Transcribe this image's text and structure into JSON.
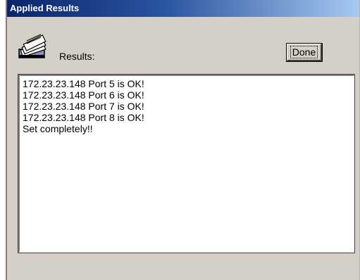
{
  "window": {
    "title": "Applied Results"
  },
  "header": {
    "icon": "card-file-icon",
    "results_label": "Results:"
  },
  "toolbar": {
    "done_label": "Done"
  },
  "results": {
    "lines": [
      "172.23.23.148 Port 5 is OK!",
      "172.23.23.148 Port 6 is OK!",
      "172.23.23.148 Port 7 is OK!",
      "172.23.23.148 Port 8 is OK!",
      "Set completely!!"
    ]
  },
  "colors": {
    "titlebar_start": "#0a246a",
    "titlebar_end": "#a6caf0",
    "window_bg": "#d4d0c8"
  }
}
